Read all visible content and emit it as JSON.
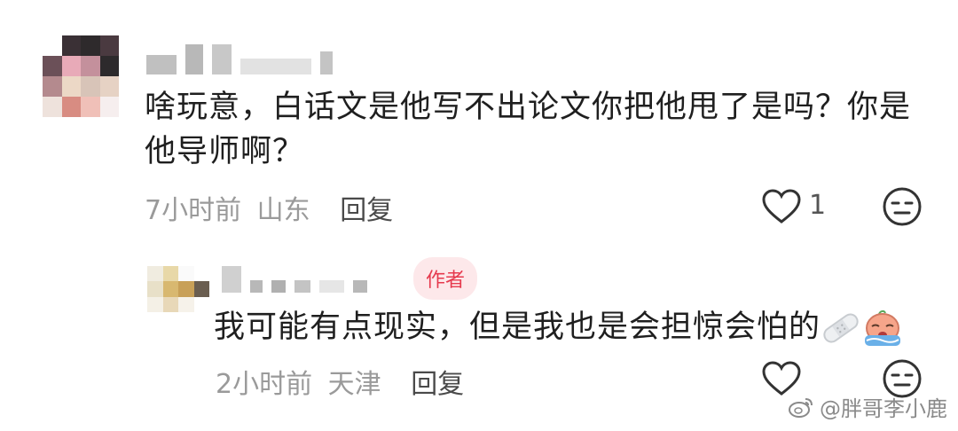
{
  "comment": {
    "text": "啥玩意，白话文是他写不出论文你把他甩了是吗？你是他导师啊？",
    "time": "7小时前",
    "location": "山东",
    "reply_label": "回复",
    "like_count": "1",
    "like_icon": "heart-outline-icon",
    "dislike_icon": "meh-face-icon"
  },
  "reply": {
    "author_badge": "作者",
    "text": "我可能有点现实，但是我也是会担惊会怕的",
    "emoji_icons": [
      "bandage-icon",
      "crying-face-icon"
    ],
    "time": "2小时前",
    "location": "天津",
    "reply_label": "回复",
    "like_icon": "heart-outline-icon",
    "dislike_icon": "meh-face-icon"
  },
  "watermark": "@胖哥李小鹿",
  "colors": {
    "badge_bg": "#fde8ea",
    "badge_text": "#e63a4e",
    "muted": "#9a9a9a"
  }
}
